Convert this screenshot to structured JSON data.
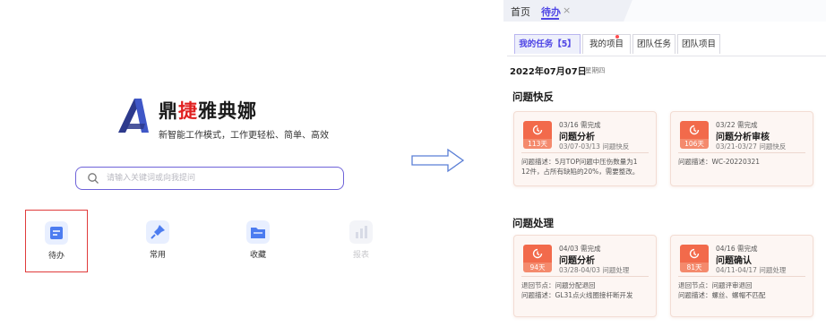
{
  "home": {
    "brand": {
      "name_part1": "鼎",
      "name_part2": "捷",
      "name_part3": "雅典娜",
      "slogan": "新智能工作模式，工作更轻松、简单、高效"
    },
    "search": {
      "placeholder": "请输入关键词或向我提问",
      "value": ""
    },
    "quick_actions": [
      {
        "label": "待办",
        "icon": "todo-icon",
        "selected": true
      },
      {
        "label": "常用",
        "icon": "pin-icon"
      },
      {
        "label": "收藏",
        "icon": "folder-icon"
      },
      {
        "label": "报表",
        "icon": "report-icon",
        "disabled": true
      }
    ]
  },
  "task_panel": {
    "top_tabs": {
      "home": "首页",
      "todo": "待办",
      "close": "×"
    },
    "sub_tabs": [
      "我的任务【5】",
      "我的项目",
      "团队任务",
      "团队项目"
    ],
    "date": "2022年07月07日",
    "weekday": "星期四",
    "sections": [
      {
        "title": "问题快反",
        "cards": [
          {
            "due": "03/16 需完成",
            "title": "问题分析",
            "days": "113天",
            "range": "03/07-03/13 问题快反",
            "lines": [
              "问题描述：5月TOP问题中压伤数量为1",
              "12件，占所有缺陷的20%，需要整改。"
            ]
          },
          {
            "due": "03/22 需完成",
            "title": "问题分析审核",
            "days": "106天",
            "range": "03/21-03/27 问题快反",
            "lines": [
              "问题描述：WC-20220321"
            ]
          }
        ]
      },
      {
        "title": "问题处理",
        "cards": [
          {
            "due": "04/03 需完成",
            "title": "问题分析",
            "days": "94天",
            "range": "03/28-04/03 问题处理",
            "lines": [
              "退回节点：问题分配退回",
              "问题描述：GL31点火线圈接杆断开发"
            ]
          },
          {
            "due": "04/16 需完成",
            "title": "问题确认",
            "days": "81天",
            "range": "04/11-04/17 问题处理",
            "lines": [
              "退回节点：问题评审退回",
              "问题描述：螺丝、螺帽不匹配"
            ]
          }
        ]
      }
    ]
  },
  "colors": {
    "accent": "#4f46e5",
    "badge": "#f26a4b",
    "highlight_border": "#e03b3b"
  }
}
